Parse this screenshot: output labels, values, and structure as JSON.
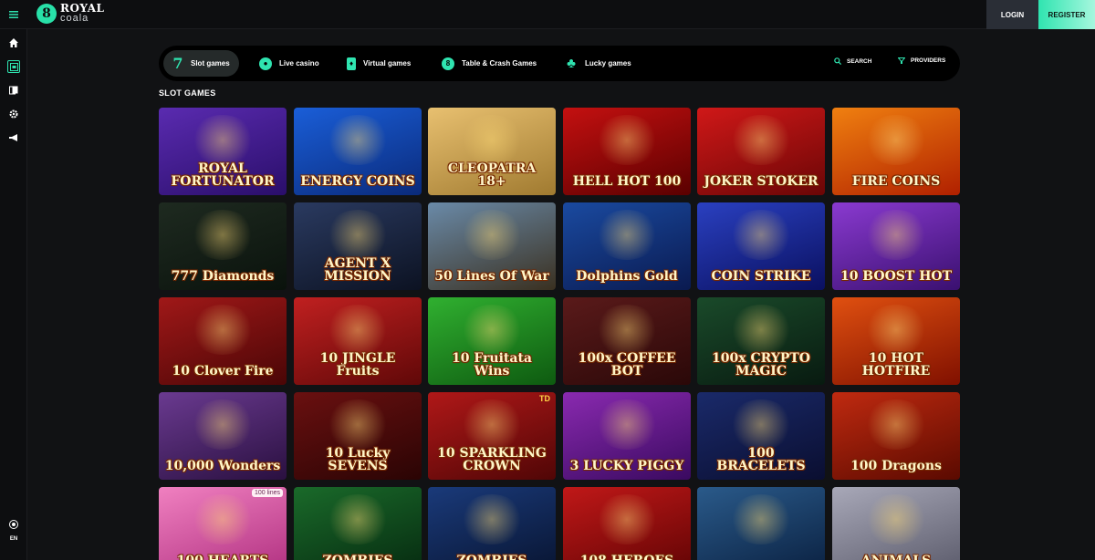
{
  "header": {
    "logo_top": "ROYAL",
    "logo_bottom": "coala",
    "login_label": "LOGIN",
    "register_label": "REGISTER"
  },
  "sidebar": {
    "items": [
      "home-icon",
      "slots-icon",
      "cards-icon",
      "settings-icon",
      "megaphone-icon"
    ],
    "language": "EN"
  },
  "nav": {
    "tabs": [
      {
        "label": "Slot games",
        "icon": "seven-icon",
        "active": true
      },
      {
        "label": "Live casino",
        "icon": "live-icon",
        "active": false
      },
      {
        "label": "Virtual games",
        "icon": "virtual-icon",
        "active": false
      },
      {
        "label": "Table & Crash Games",
        "icon": "table-icon",
        "active": false
      },
      {
        "label": "Lucky games",
        "icon": "clover-icon",
        "active": false
      }
    ],
    "search_label": "SEARCH",
    "providers_label": "PROVIDERS"
  },
  "section_title": "SLOT GAMES",
  "accent_color": "#2fe4b0",
  "games": [
    {
      "name": "ROYAL FORTUNATOR",
      "bg": "linear-gradient(160deg,#5a2bb0,#2a0e6a)"
    },
    {
      "name": "ENERGY COINS",
      "bg": "linear-gradient(160deg,#1a5ed8,#0a2a7a)"
    },
    {
      "name": "CLEOPATRA 18+",
      "bg": "linear-gradient(160deg,#e8c070,#a07a30)"
    },
    {
      "name": "HELL HOT 100",
      "bg": "linear-gradient(160deg,#c41010,#5a0000)"
    },
    {
      "name": "JOKER STOKER",
      "bg": "linear-gradient(160deg,#d01818,#6a0606)"
    },
    {
      "name": "FIRE COINS",
      "bg": "linear-gradient(160deg,#f08010,#b02000)"
    },
    {
      "name": "777 Diamonds",
      "bg": "linear-gradient(160deg,#1e2a20,#0a120c)"
    },
    {
      "name": "AGENT X MISSION",
      "bg": "linear-gradient(160deg,#2a3a60,#0c1222)"
    },
    {
      "name": "50 Lines Of War",
      "bg": "linear-gradient(160deg,#6a8aa8,#3a3020)"
    },
    {
      "name": "Dolphins Gold",
      "bg": "linear-gradient(160deg,#1a4aa0,#0a1a50)"
    },
    {
      "name": "COIN STRIKE",
      "bg": "linear-gradient(160deg,#2a40c0,#0a1060)"
    },
    {
      "name": "10 BOOST HOT",
      "bg": "linear-gradient(160deg,#8a3ad0,#3a1070)"
    },
    {
      "name": "10 Clover Fire",
      "bg": "linear-gradient(160deg,#a01818,#4a0606)"
    },
    {
      "name": "10 JINGLE Fruits",
      "bg": "linear-gradient(160deg,#c02020,#600808)"
    },
    {
      "name": "10 Fruitata Wins",
      "bg": "linear-gradient(160deg,#30b030,#0e5a10)"
    },
    {
      "name": "100x COFFEE BOT",
      "bg": "linear-gradient(160deg,#5a1a1a,#2a0808)"
    },
    {
      "name": "100x CRYPTO MAGIC",
      "bg": "linear-gradient(160deg,#1a4a2a,#081a10)"
    },
    {
      "name": "10 HOT HOTFIRE",
      "bg": "linear-gradient(160deg,#e05010,#801000)"
    },
    {
      "name": "10,000 Wonders",
      "bg": "linear-gradient(160deg,#6a3a90,#2a1040)"
    },
    {
      "name": "10 Lucky SEVENS",
      "bg": "linear-gradient(160deg,#6a1010,#2a0404)"
    },
    {
      "name": "10 SPARKLING CROWN",
      "bg": "linear-gradient(160deg,#b01818,#500606)"
    },
    {
      "name": "3 LUCKY PIGGY",
      "bg": "linear-gradient(160deg,#8a2ab0,#3a0a60)"
    },
    {
      "name": "100 BRACELETS",
      "bg": "linear-gradient(160deg,#1a2a6a,#0a0e30)"
    },
    {
      "name": "100 Dragons",
      "bg": "linear-gradient(160deg,#c02a10,#5a0a00)"
    },
    {
      "name": "100 HEARTS",
      "bg": "linear-gradient(160deg,#f080c0,#b03080)"
    },
    {
      "name": "ZOMBIES",
      "bg": "linear-gradient(160deg,#1a6a2a,#062a10)"
    },
    {
      "name": "ZOMBIES",
      "bg": "linear-gradient(160deg,#1a3a7a,#081430)"
    },
    {
      "name": "108 HEROES",
      "bg": "linear-gradient(160deg,#c01818,#600404)"
    },
    {
      "name": "",
      "bg": "linear-gradient(160deg,#2a5a8a,#0a2040)"
    },
    {
      "name": "ANIMALS",
      "bg": "linear-gradient(160deg,#a8a8b8,#5a5a6a)"
    }
  ],
  "badges": {
    "td": "TD",
    "lines": "100 lines"
  }
}
